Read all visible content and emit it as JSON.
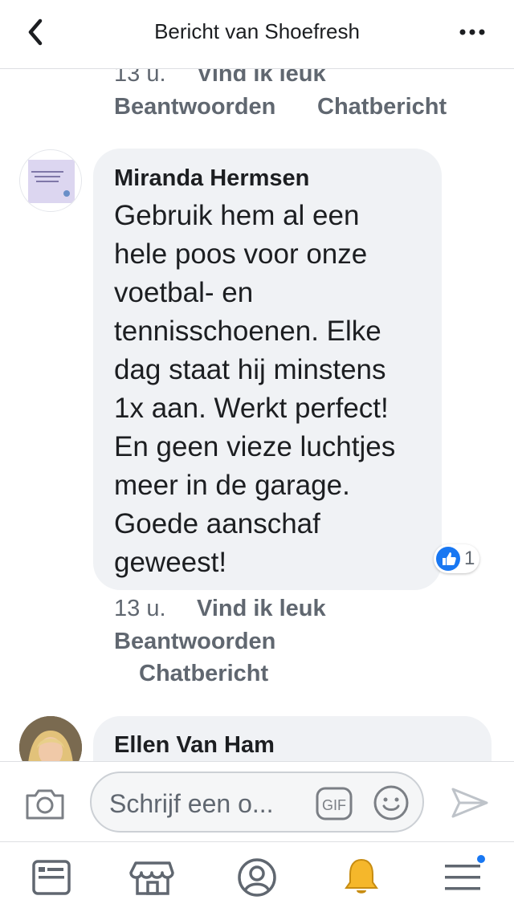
{
  "header": {
    "title": "Bericht van Shoefresh"
  },
  "top_comment_actions": {
    "time": "13 u.",
    "like": "Vind ik leuk",
    "reply": "Beantwoorden",
    "chat": "Chatbericht"
  },
  "comment": {
    "author": "Miranda Hermsen",
    "lines": [
      "Gebruik hem al een",
      "hele poos voor onze",
      "voetbal- en",
      "tennisschoenen. Elke",
      "dag staat hij minstens",
      "1x aan. Werkt perfect!",
      "En geen vieze luchtjes",
      "meer in de garage.",
      "Goede aanschaf",
      "geweest!"
    ],
    "avatar_text": "Huiten is voor mensen. Echte vrouwen gaan shoppen.",
    "reaction_count": "1",
    "time": "13 u.",
    "like": "Vind ik leuk",
    "reply": "Beantwoorden",
    "chat": "Chatbericht"
  },
  "next_comment": {
    "author": "Ellen Van Ham"
  },
  "composer": {
    "placeholder": "Schrijf een o...",
    "gif_label": "GIF"
  },
  "tabbar": {
    "items": [
      "news-feed",
      "marketplace",
      "profile",
      "notifications",
      "menu"
    ],
    "active": "notifications"
  },
  "colors": {
    "accent": "#1877f2",
    "bubble": "#f0f2f5",
    "meta_text": "#606770",
    "bell": "#f5b72b"
  }
}
